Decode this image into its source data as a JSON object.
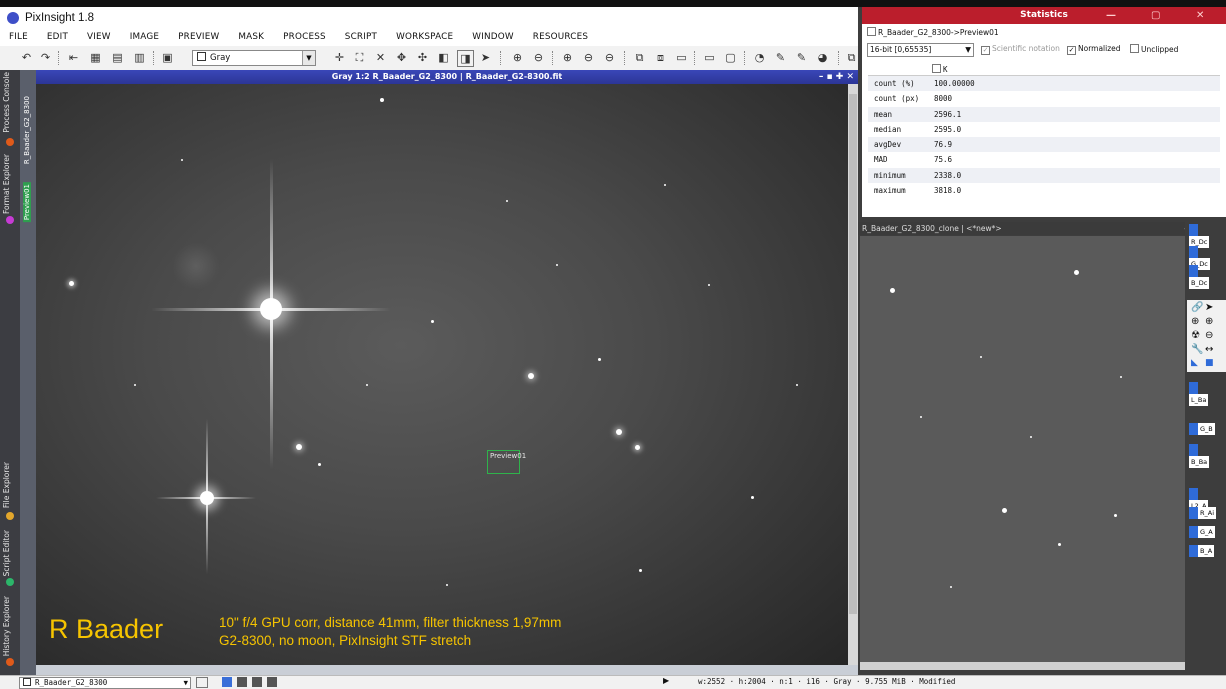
{
  "app": {
    "title": "PixInsight 1.8"
  },
  "menu": [
    "FILE",
    "EDIT",
    "VIEW",
    "IMAGE",
    "PREVIEW",
    "MASK",
    "PROCESS",
    "SCRIPT",
    "WORKSPACE",
    "WINDOW",
    "RESOURCES"
  ],
  "toolbar": {
    "color_mode": "Gray"
  },
  "left_tabs": {
    "process_console": "Process Console",
    "format_explorer": "Format Explorer",
    "file_explorer": "File Explorer",
    "script_editor": "Script Editor",
    "history_explorer": "History Explorer"
  },
  "side_tabs": {
    "image": "R_Baader_G2_8300",
    "preview": "Preview01"
  },
  "image_window": {
    "title": "Gray 1:2 R_Baader_G2_8300 | R_Baader_G2-8300.fit",
    "preview_label": "Preview01",
    "caption_big": "R Baader",
    "caption_line1": "10\" f/4 GPU corr, distance 41mm, filter thickness 1,97mm",
    "caption_line2": "G2-8300, no moon, PixInsight STF stretch"
  },
  "statistics": {
    "title": "Statistics",
    "source": "R_Baader_G2_8300->Preview01",
    "bit_depth": "16-bit [0,65535]",
    "scientific_notation": "Scientific notation",
    "normalized": "Normalized",
    "unclipped": "Unclipped",
    "channel": "K",
    "rows": [
      {
        "label": "count (%)",
        "value": "100.00000"
      },
      {
        "label": "count (px)",
        "value": "8000"
      },
      {
        "label": "mean",
        "value": "2596.1"
      },
      {
        "label": "median",
        "value": "2595.0"
      },
      {
        "label": "avgDev",
        "value": "76.9"
      },
      {
        "label": "MAD",
        "value": "75.6"
      },
      {
        "label": "minimum",
        "value": "2338.0"
      },
      {
        "label": "maximum",
        "value": "3818.0"
      }
    ]
  },
  "clone_window": {
    "title": "R_Baader_G2_8300_clone | <*new*>"
  },
  "icons": [
    "R_Dc",
    "G_Dc",
    "B_Dc",
    "L_Ba",
    "G_B",
    "B_Ba",
    "L2_A",
    "R_Ai",
    "G_A",
    "B_A"
  ],
  "statusbar": {
    "view": "R_Baader_G2_8300",
    "info": "w:2552 · h:2004 · n:1 · i16 · Gray · 9.755 MiB · Modified"
  }
}
